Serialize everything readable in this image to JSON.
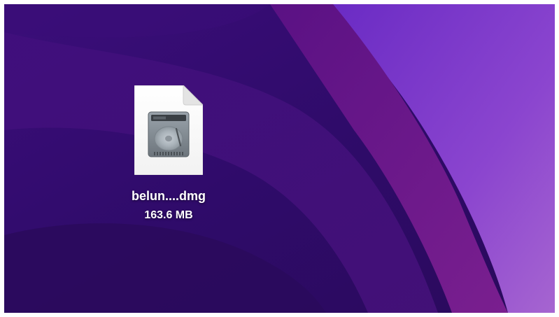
{
  "desktop": {
    "wallpaper_colors": {
      "deep": "#2a0b63",
      "mid": "#3c0f78",
      "accent": "#6a1a8a",
      "light": "#8b3fc9"
    },
    "file": {
      "icon": "disk-image-icon",
      "name": "belun....dmg",
      "size": "163.6 MB"
    }
  }
}
